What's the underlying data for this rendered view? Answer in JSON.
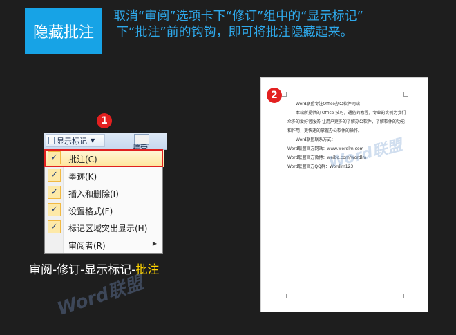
{
  "header": {
    "badge": "隐藏批注",
    "instruction_line1": "取消“审阅”选项卡下“修订”组中的“显示标记”",
    "instruction_line2": "下“批注”前的钩钩，即可将批注隐藏起来。"
  },
  "steps": [
    "1",
    "2"
  ],
  "ribbon": {
    "dropdown_label": "显示标记",
    "side_button_label": "接受"
  },
  "menu": {
    "items": [
      {
        "label": "批注(C)",
        "checked": true
      },
      {
        "label": "墨迹(K)",
        "checked": true
      },
      {
        "label": "插入和删除(I)",
        "checked": true
      },
      {
        "label": "设置格式(F)",
        "checked": true
      },
      {
        "label": "标记区域突出显示(H)",
        "checked": true
      },
      {
        "label": "审阅者(R)",
        "checked": false
      }
    ]
  },
  "caption": {
    "path": "审阅-修订-显示标记-",
    "highlight": "批注"
  },
  "watermark": "Word联盟",
  "document": {
    "lines": [
      "Word联盟专注Office办公软件网站",
      "本站所提供的 Office 技巧，通俗的教程，专业的实例为我们",
      "众多的爱好者服务 让用户更多的了解办公软件，了解软件的功能",
      "和作用，更快速的掌握办公软件的操作。",
      "Word联盟联系方式：",
      "Word联盟官方网站：www.wordlm.com",
      "Word联盟官方微博：weibo.com/wordlm",
      "Word联盟官方QQ群：Wordlm123"
    ]
  },
  "colors": {
    "background": "#1e1e1e",
    "accent_blue": "#17a3e6",
    "instruction_text": "#2ea8ea",
    "step_marker": "#e32020",
    "highlight_text": "#ffd400"
  }
}
